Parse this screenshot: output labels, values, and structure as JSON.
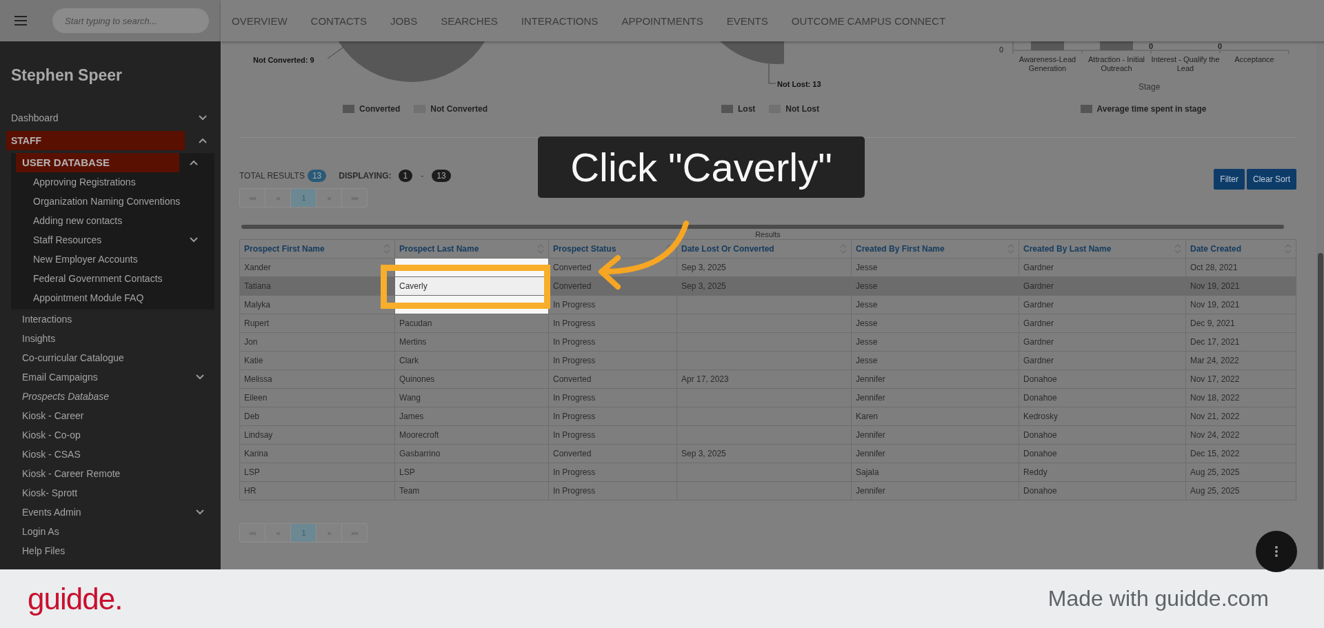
{
  "header": {
    "search_placeholder": "Start typing to search...",
    "nav": [
      {
        "label": "OVERVIEW"
      },
      {
        "label": "CONTACTS"
      },
      {
        "label": "JOBS"
      },
      {
        "label": "SEARCHES"
      },
      {
        "label": "INTERACTIONS"
      },
      {
        "label": "APPOINTMENTS"
      },
      {
        "label": "EVENTS"
      },
      {
        "label": "OUTCOME CAMPUS CONNECT"
      }
    ]
  },
  "sidebar": {
    "user_name": "Stephen Speer",
    "items": [
      {
        "label": "Dashboard",
        "kind": "link",
        "expanded": false,
        "current": false
      },
      {
        "label": "STAFF",
        "kind": "section",
        "expanded": true,
        "current": false,
        "children": [
          {
            "label": "USER DATABASE",
            "kind": "subsection",
            "expanded": true,
            "current": false,
            "children": [
              {
                "label": "Approving Registrations",
                "kind": "link",
                "current": false
              },
              {
                "label": "Organization Naming Conventions",
                "kind": "link",
                "current": false
              },
              {
                "label": "Adding new contacts",
                "kind": "link",
                "current": false
              },
              {
                "label": "Staff Resources",
                "kind": "link",
                "expanded": false,
                "current": false
              },
              {
                "label": "New Employer Accounts",
                "kind": "link",
                "current": false
              },
              {
                "label": "Federal Government Contacts",
                "kind": "link",
                "current": false
              },
              {
                "label": "Appointment Module FAQ",
                "kind": "link",
                "current": false
              }
            ]
          },
          {
            "label": "Interactions",
            "kind": "link",
            "current": false
          },
          {
            "label": "Insights",
            "kind": "link",
            "current": false
          },
          {
            "label": "Co-curricular Catalogue",
            "kind": "link",
            "current": false
          },
          {
            "label": "Email Campaigns",
            "kind": "link",
            "expanded": false,
            "current": false
          },
          {
            "label": "Prospects Database",
            "kind": "link",
            "current": true
          },
          {
            "label": "Kiosk - Career",
            "kind": "link",
            "current": false
          },
          {
            "label": "Kiosk - Co-op",
            "kind": "link",
            "current": false
          },
          {
            "label": "Kiosk - CSAS",
            "kind": "link",
            "current": false
          },
          {
            "label": "Kiosk - Career Remote",
            "kind": "link",
            "current": false
          },
          {
            "label": "Kiosk- Sprott",
            "kind": "link",
            "current": false
          },
          {
            "label": "Events Admin",
            "kind": "link",
            "expanded": false,
            "current": false
          },
          {
            "label": "Login As",
            "kind": "link",
            "current": false
          },
          {
            "label": "Help Files",
            "kind": "link",
            "current": false
          }
        ]
      }
    ]
  },
  "charts": [
    {
      "kind": "pie",
      "labels": [
        "Not Converted: 9"
      ],
      "legend": [
        {
          "label": "Converted",
          "color": "#555555"
        },
        {
          "label": "Not Converted",
          "color": "#717171"
        }
      ]
    },
    {
      "kind": "pie",
      "labels": [
        "Not Lost: 13"
      ],
      "legend": [
        {
          "label": "Lost",
          "color": "#555555"
        },
        {
          "label": "Not Lost",
          "color": "#717171"
        }
      ]
    },
    {
      "kind": "bar",
      "y_tick": "0",
      "xlabel": "Stage",
      "categories": [
        {
          "label": "Awareness-Lead Generation",
          "kind": "bar"
        },
        {
          "label": "Attraction - Initial Outreach",
          "kind": "bar"
        },
        {
          "label": "Interest - Qualify the Lead",
          "kind": "zero",
          "value_label": "0"
        },
        {
          "label": "Acceptance",
          "kind": "zero",
          "value_label": "0"
        }
      ],
      "legend": [
        {
          "label": "Average time spent in stage",
          "color": "#555555"
        }
      ]
    }
  ],
  "results": {
    "total_label": "TOTAL RESULTS",
    "total": "13",
    "displaying_label": "DISPLAYING:",
    "from": "1",
    "separator": "-",
    "to": "13"
  },
  "pagination_top": [
    {
      "label": "««",
      "selected": false
    },
    {
      "label": "«",
      "selected": false
    },
    {
      "label": "1",
      "selected": true
    },
    {
      "label": "»",
      "selected": false
    },
    {
      "label": "»»",
      "selected": false
    }
  ],
  "buttons": [
    "Filter",
    "Clear Sort"
  ],
  "table": {
    "caption": "Results",
    "columns": [
      {
        "label": "Prospect First Name",
        "spotlight": false
      },
      {
        "label": "Prospect Last Name",
        "spotlight": true
      },
      {
        "label": "Prospect Status",
        "spotlight": false
      },
      {
        "label": "Date Lost Or Converted",
        "spotlight": false
      },
      {
        "label": "Created By First Name",
        "spotlight": false
      },
      {
        "label": "Created By Last Name",
        "spotlight": false
      },
      {
        "label": "Date Created",
        "spotlight": false
      }
    ],
    "rows": [
      {
        "first_name": "Xander",
        "status": "Converted",
        "date_lost_or_converted": "Sep 3, 2025",
        "created_by_first": "Jesse",
        "created_by_last": "Gardner",
        "date_created": "Oct 28, 2021",
        "selected": false,
        "spotlight": true
      },
      {
        "first_name": "Tatiana",
        "last_name": "Caverly",
        "status": "Converted",
        "date_lost_or_converted": "Sep 3, 2025",
        "created_by_first": "Jesse",
        "created_by_last": "Gardner",
        "date_created": "Nov 19, 2021",
        "selected": true,
        "spotlight": true
      },
      {
        "first_name": "Malyka",
        "status": "In Progress",
        "created_by_first": "Jesse",
        "created_by_last": "Gardner",
        "date_created": "Nov 19, 2021",
        "selected": false,
        "spotlight": true
      },
      {
        "first_name": "Rupert",
        "last_name": "Pacudan",
        "status": "In Progress",
        "created_by_first": "Jesse",
        "created_by_last": "Gardner",
        "date_created": "Dec 9, 2021",
        "selected": false,
        "spotlight": false
      },
      {
        "first_name": "Jon",
        "last_name": "Mertins",
        "status": "In Progress",
        "created_by_first": "Jesse",
        "created_by_last": "Gardner",
        "date_created": "Dec 17, 2021",
        "selected": false,
        "spotlight": false
      },
      {
        "first_name": "Katie",
        "last_name": "Clark",
        "status": "In Progress",
        "created_by_first": "Jesse",
        "created_by_last": "Gardner",
        "date_created": "Mar 24, 2022",
        "selected": false,
        "spotlight": false
      },
      {
        "first_name": "Melissa",
        "last_name": "Quinones",
        "status": "Converted",
        "date_lost_or_converted": "Apr 17, 2023",
        "created_by_first": "Jennifer",
        "created_by_last": "Donahoe",
        "date_created": "Nov 17, 2022",
        "selected": false,
        "spotlight": false
      },
      {
        "first_name": "Eileen",
        "last_name": "Wang",
        "status": "In Progress",
        "created_by_first": "Jennifer",
        "created_by_last": "Donahoe",
        "date_created": "Nov 18, 2022",
        "selected": false,
        "spotlight": false
      },
      {
        "first_name": "Deb",
        "last_name": "James",
        "status": "In Progress",
        "created_by_first": "Karen",
        "created_by_last": "Kedrosky",
        "date_created": "Nov 21, 2022",
        "selected": false,
        "spotlight": false
      },
      {
        "first_name": "Lindsay",
        "last_name": "Moorecroft",
        "status": "In Progress",
        "created_by_first": "Jennifer",
        "created_by_last": "Donahoe",
        "date_created": "Nov 24, 2022",
        "selected": false,
        "spotlight": false
      },
      {
        "first_name": "Karina",
        "last_name": "Gasbarrino",
        "status": "Converted",
        "date_lost_or_converted": "Sep 3, 2025",
        "created_by_first": "Jennifer",
        "created_by_last": "Donahoe",
        "date_created": "Dec 15, 2022",
        "selected": false,
        "spotlight": false
      },
      {
        "first_name": "LSP",
        "last_name": "LSP",
        "status": "In Progress",
        "created_by_first": "Sajala",
        "created_by_last": "Reddy",
        "date_created": "Aug 25, 2025",
        "selected": false,
        "spotlight": false
      },
      {
        "first_name": "HR",
        "last_name": "Team",
        "status": "In Progress",
        "created_by_first": "Jennifer",
        "created_by_last": "Donahoe",
        "date_created": "Aug 25, 2025",
        "selected": false,
        "spotlight": false
      }
    ]
  },
  "pagination_bottom": [
    {
      "label": "««",
      "selected": false
    },
    {
      "label": "«",
      "selected": false
    },
    {
      "label": "1",
      "selected": true
    },
    {
      "label": "»",
      "selected": false
    },
    {
      "label": "»»",
      "selected": false
    }
  ],
  "callout": {
    "text": "Click \"Caverly\""
  },
  "footer": {
    "brand": "guidde.",
    "text": "Made with guidde.com"
  }
}
